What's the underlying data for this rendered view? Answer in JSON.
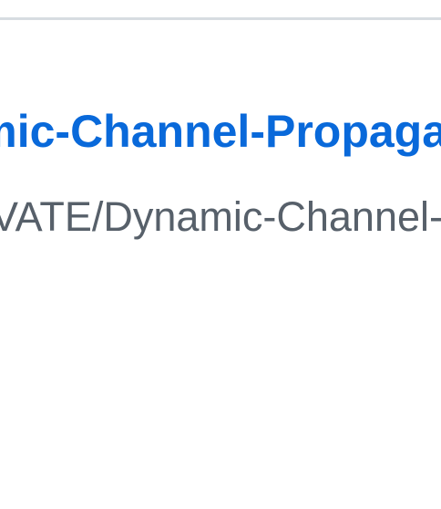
{
  "repository": {
    "title": "Dynamic-Channel-Propagation",
    "path": "VATE/Dynamic-Channel-Propagation"
  },
  "colors": {
    "link": "#0969da",
    "secondary_text": "#57606a",
    "divider": "#d7dce1",
    "background": "#ffffff"
  }
}
